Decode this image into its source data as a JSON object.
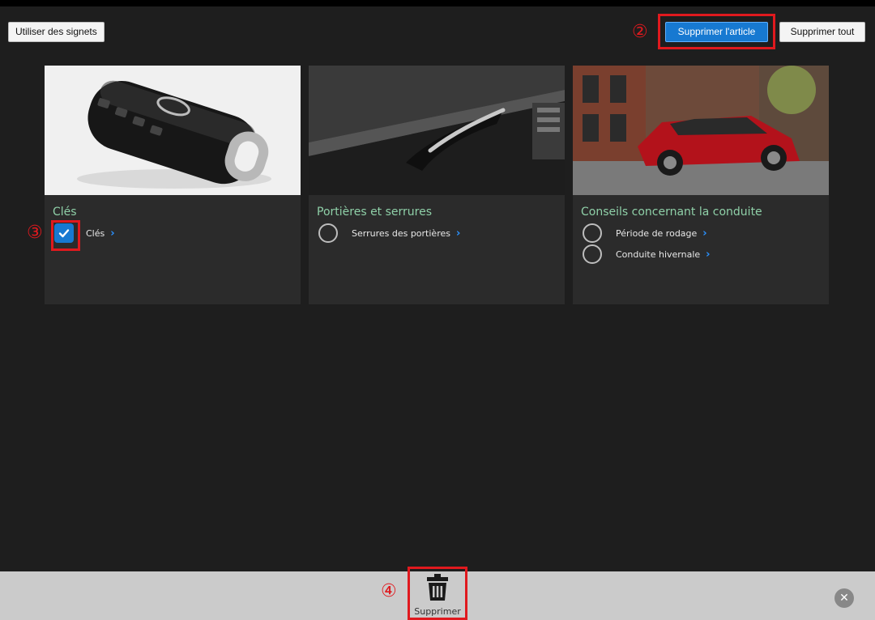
{
  "toolbar": {
    "bookmarks_label": "Utiliser des signets",
    "delete_article_label": "Supprimer l'article",
    "delete_all_label": "Supprimer tout"
  },
  "steps": {
    "step2": "②",
    "step3": "③",
    "step4": "④"
  },
  "cards": [
    {
      "title": "Clés",
      "items": [
        {
          "label": "Clés",
          "checked": true
        }
      ]
    },
    {
      "title": "Portières et serrures",
      "items": [
        {
          "label": "Serrures des portières",
          "checked": false
        }
      ]
    },
    {
      "title": "Conseils concernant la conduite",
      "items": [
        {
          "label": "Période de rodage",
          "checked": false
        },
        {
          "label": "Conduite hivernale",
          "checked": false
        }
      ]
    }
  ],
  "bottom": {
    "delete_label": "Supprimer",
    "close_symbol": "✕"
  },
  "colors": {
    "accent_blue": "#1779d1",
    "highlight_red": "#e0191e",
    "title_green": "#8fd0a8",
    "bottom_bar": "#cbcbcb"
  }
}
